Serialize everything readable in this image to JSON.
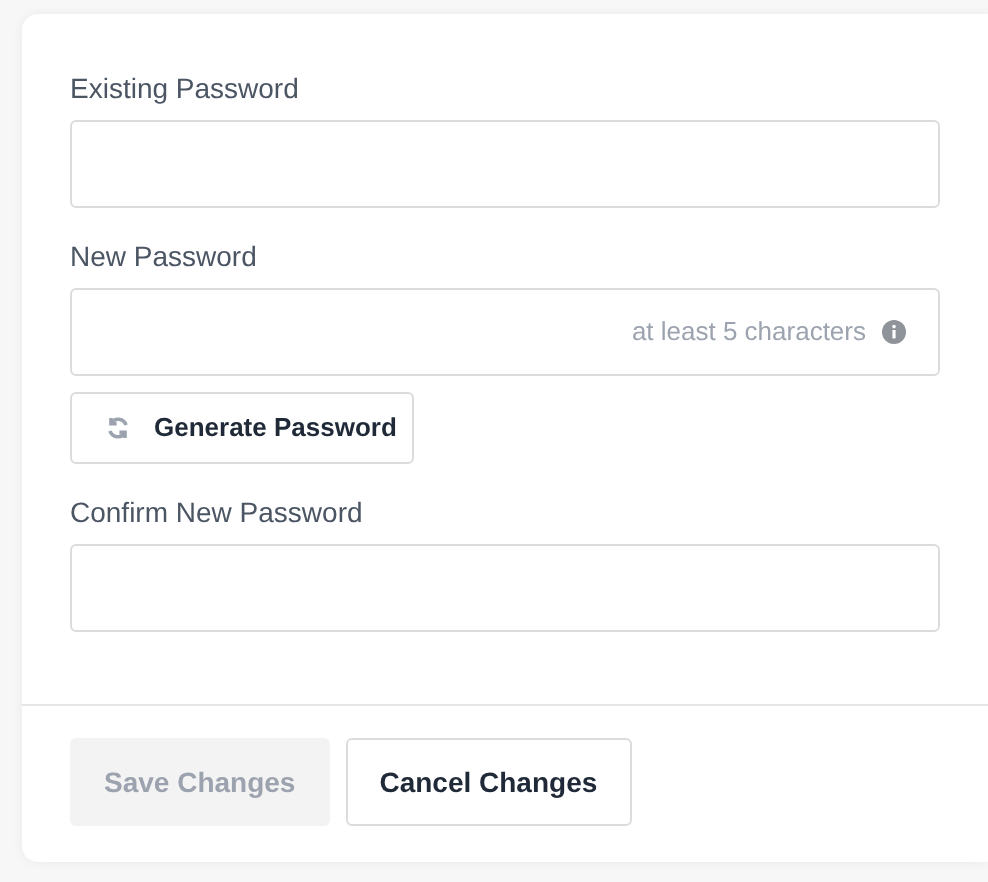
{
  "fields": [
    {
      "label": "Existing Password"
    },
    {
      "label": "New Password",
      "hint": "at least 5 characters"
    },
    {
      "label": "Confirm New Password"
    }
  ],
  "generate_button": {
    "label": "Generate Password"
  },
  "buttons": [
    {
      "label": "Save Changes",
      "disabled": true
    },
    {
      "label": "Cancel Changes",
      "disabled": false
    }
  ]
}
